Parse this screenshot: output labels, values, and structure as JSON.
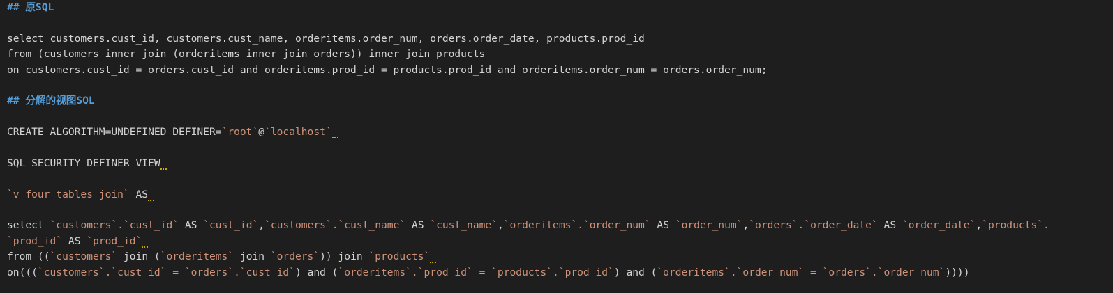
{
  "heading1": "## 原SQL",
  "orig_sql": [
    "select customers.cust_id, customers.cust_name, orderitems.order_num, orders.order_date, products.prod_id",
    "from (customers inner join (orderitems inner join orders)) inner join products",
    "on customers.cust_id = orders.cust_id and orderitems.prod_id = products.prod_id and orderitems.order_num = orders.order_num;"
  ],
  "heading2": "## 分解的视图SQL",
  "view_sql": {
    "line1_plain": "CREATE ALGORITHM=UNDEFINED DEFINER=",
    "line1_user": "`root`",
    "line1_at": "@",
    "line1_host": "`localhost`",
    "line2": "SQL SECURITY DEFINER VIEW",
    "line3_name": "`v_four_tables_join`",
    "line3_as": " AS",
    "sel_a": "select ",
    "sel_b": "`customers`.`cust_id`",
    "sel_c": " AS ",
    "sel_d": "`cust_id`",
    "sel_e": ",",
    "sel_f": "`customers`.`cust_name`",
    "sel_g": " AS ",
    "sel_h": "`cust_name`",
    "sel_i": ",",
    "sel_j": "`orderitems`.`order_num`",
    "sel_k": " AS ",
    "sel_l": "`order_num`",
    "sel_m": ",",
    "sel_n": "`orders`.`order_date`",
    "sel_o": " AS ",
    "sel_p": "`order_date`",
    "sel_q": ",",
    "sel_r": "`products`.",
    "sel2_a": "`prod_id`",
    "sel2_b": " AS ",
    "sel2_c": "`prod_id`",
    "from_a": "from ((",
    "from_b": "`customers`",
    "from_c": " join (",
    "from_d": "`orderitems`",
    "from_e": " join ",
    "from_f": "`orders`",
    "from_g": ")) join ",
    "from_h": "`products`",
    "on_a": "on(((",
    "on_b": "`customers`.`cust_id`",
    "on_c": " = ",
    "on_d": "`orders`.`cust_id`",
    "on_e": ") and (",
    "on_f": "`orderitems`.`prod_id`",
    "on_g": " = ",
    "on_h": "`products`.`prod_id`",
    "on_i": ") and (",
    "on_j": "`orderitems`.`order_num`",
    "on_k": " = ",
    "on_l": "`orders`.`order_num`",
    "on_m": "))))"
  },
  "colors": {
    "background": "#1e1e1e",
    "text": "#d4d4d4",
    "heading": "#569cd6",
    "backtick_identifier": "#ce9178",
    "warning_squiggle": "#cca700"
  }
}
